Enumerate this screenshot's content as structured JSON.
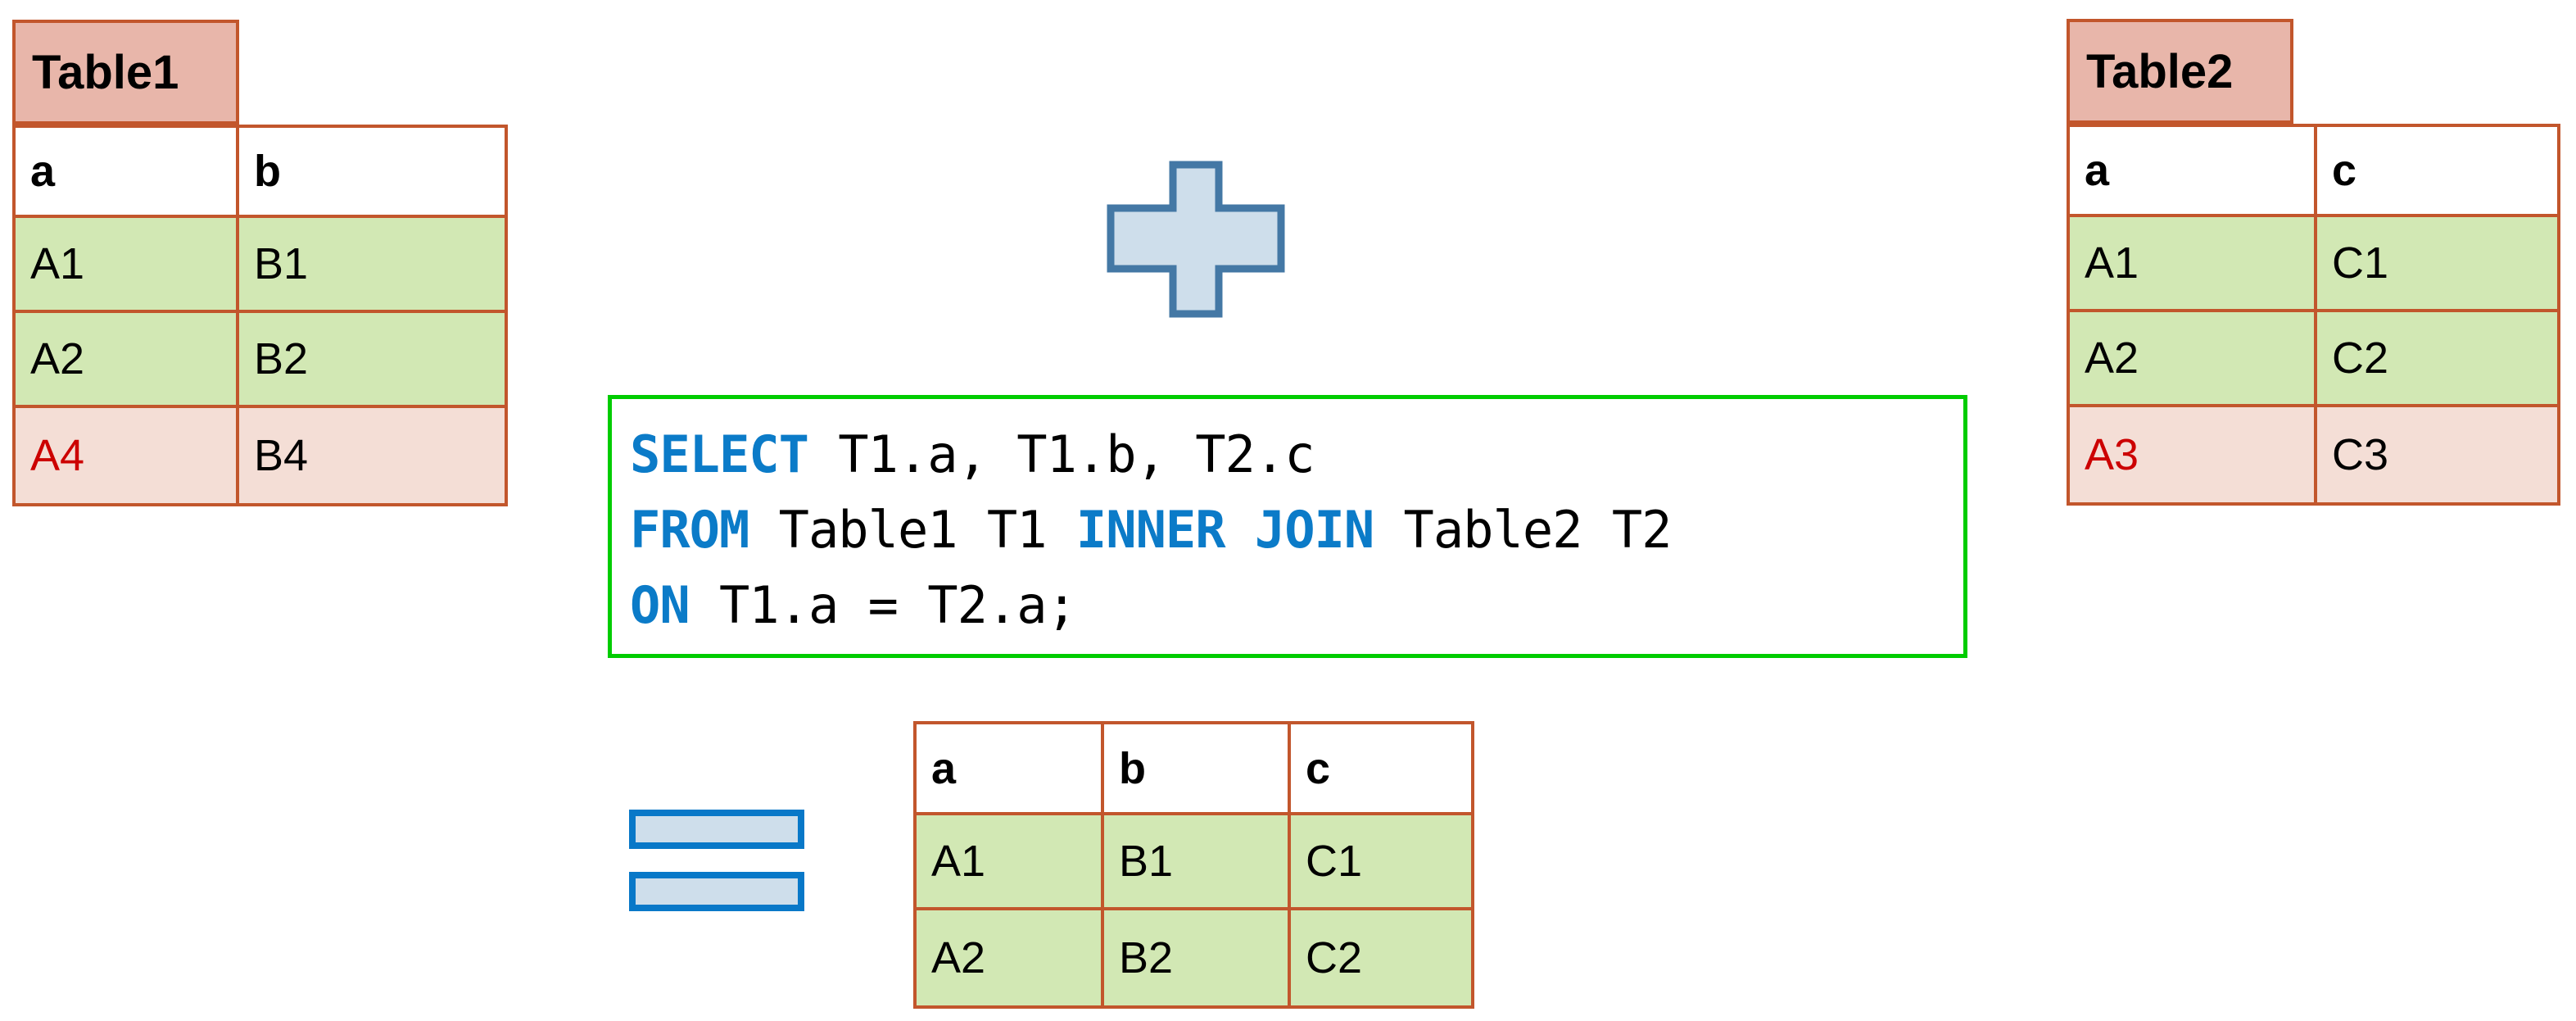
{
  "diagram": {
    "title": "SQL INNER JOIN illustration",
    "colors": {
      "table_border": "#C2562C",
      "tab_fill": "#E8B6AA",
      "match_row_fill": "#D2E8B4",
      "unmatched_row_fill": "#F4DED6",
      "header_fill": "#FFFFFF",
      "highlight_text": "#CC0000",
      "sql_box_border": "#00CC00",
      "sql_keyword": "#0B7BC8",
      "plus_fill": "#CEDEEB",
      "plus_stroke": "#4478A5",
      "equals_fill": "#CEDEEB",
      "equals_stroke": "#0878C8"
    }
  },
  "table1": {
    "label": "Table1",
    "columns": [
      "a",
      "b"
    ],
    "rows": [
      {
        "cells": [
          "A1",
          "B1"
        ],
        "state": "match"
      },
      {
        "cells": [
          "A2",
          "B2"
        ],
        "state": "match"
      },
      {
        "cells": [
          "A4",
          "B4"
        ],
        "state": "unmatched"
      }
    ]
  },
  "table2": {
    "label": "Table2",
    "columns": [
      "a",
      "c"
    ],
    "rows": [
      {
        "cells": [
          "A1",
          "C1"
        ],
        "state": "match"
      },
      {
        "cells": [
          "A2",
          "C2"
        ],
        "state": "match"
      },
      {
        "cells": [
          "A3",
          "C3"
        ],
        "state": "unmatched"
      }
    ]
  },
  "result_table": {
    "label": "",
    "columns": [
      "a",
      "b",
      "c"
    ],
    "rows": [
      {
        "cells": [
          "A1",
          "B1",
          "C1"
        ],
        "state": "match"
      },
      {
        "cells": [
          "A2",
          "B2",
          "C2"
        ],
        "state": "match"
      }
    ]
  },
  "sql": {
    "line1_keyword": "SELECT",
    "line1_rest": " T1.a, T1.b, T2.c",
    "line2_keyword_a": "FROM",
    "line2_mid_a": " Table1 T1 ",
    "line2_keyword_b": "INNER JOIN",
    "line2_mid_b": " Table2 T2",
    "line3_keyword": "ON",
    "line3_rest": " T1.a = T2.a;",
    "full_text": "SELECT T1.a, T1.b, T2.c\nFROM Table1 T1 INNER JOIN Table2 T2\nON T1.a = T2.a;"
  },
  "operators": {
    "plus": "plus-icon",
    "equals": "equals-icon"
  }
}
